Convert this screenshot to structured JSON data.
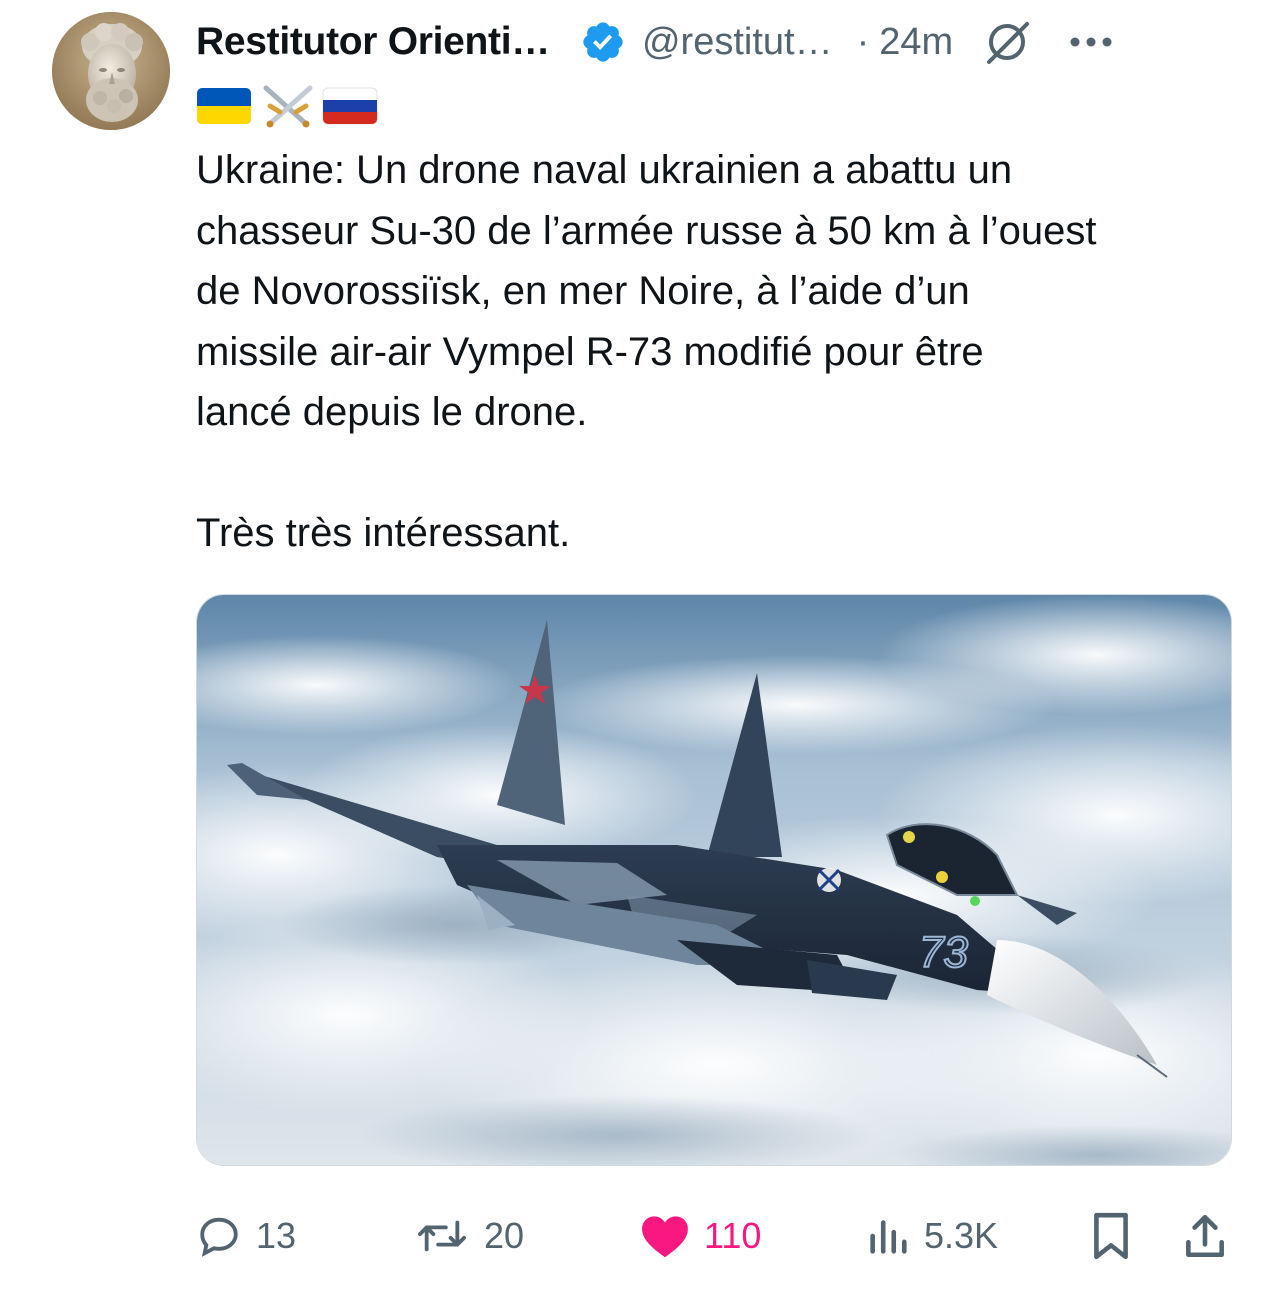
{
  "tweet": {
    "author": {
      "display_name": "Restitutor Orienti…",
      "handle": "@restitut…",
      "avatar_icon": "marble-bust-avatar",
      "verified": true,
      "verified_color": "#1d9bf0",
      "name_flags": [
        "flag-ukraine-icon",
        "crossed-swords-icon",
        "flag-russia-icon"
      ]
    },
    "separator": "·",
    "time": "24m",
    "text": "Ukraine: Un drone naval ukrainien a abattu un\nchasseur Su-30 de l’armée russe à 50 km à l’ouest\nde Novorossiïsk, en mer Noire, à l’aide d’un\nmissile air-air Vympel R-73 modifié pour être\nlancé depuis le drone.\n\nTrès très intéressant.",
    "media": {
      "description_icon": "su-30-fighter-photo",
      "tail_number": "73"
    },
    "actions": {
      "replies": "13",
      "reposts": "20",
      "likes": "110",
      "views": "5.3K",
      "liked": true,
      "like_color": "#f91880",
      "icon_color": "#536471"
    }
  }
}
